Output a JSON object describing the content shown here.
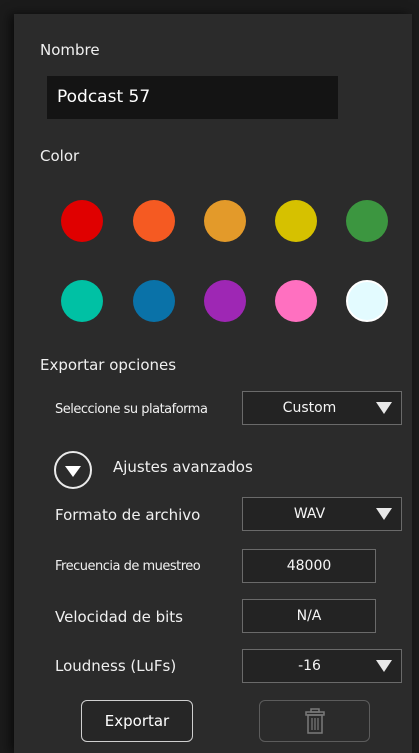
{
  "name_section": {
    "label": "Nombre",
    "value": "Podcast 57"
  },
  "color_section": {
    "label": "Color",
    "swatches": [
      "#e00000",
      "#f55a22",
      "#e39a2a",
      "#d6c100",
      "#3c9640",
      "#00c1a4",
      "#0a72a8",
      "#9e27b4",
      "#ff70c0",
      "#e3fbff"
    ],
    "selected_index": 9
  },
  "export_section": {
    "label": "Exportar opciones",
    "platform_label": "Seleccione su plataforma",
    "platform_value": "Custom",
    "advanced_label": "Ajustes avanzados",
    "format_label": "Formato de archivo",
    "format_value": "WAV",
    "samplerate_label": "Frecuencia de muestreo",
    "samplerate_value": "48000",
    "bitrate_label": "Velocidad de bits",
    "bitrate_value": "N/A",
    "loudness_label": "Loudness (LuFs)",
    "loudness_value": "-16"
  },
  "actions": {
    "export_label": "Exportar",
    "delete_icon": "trash-icon"
  }
}
